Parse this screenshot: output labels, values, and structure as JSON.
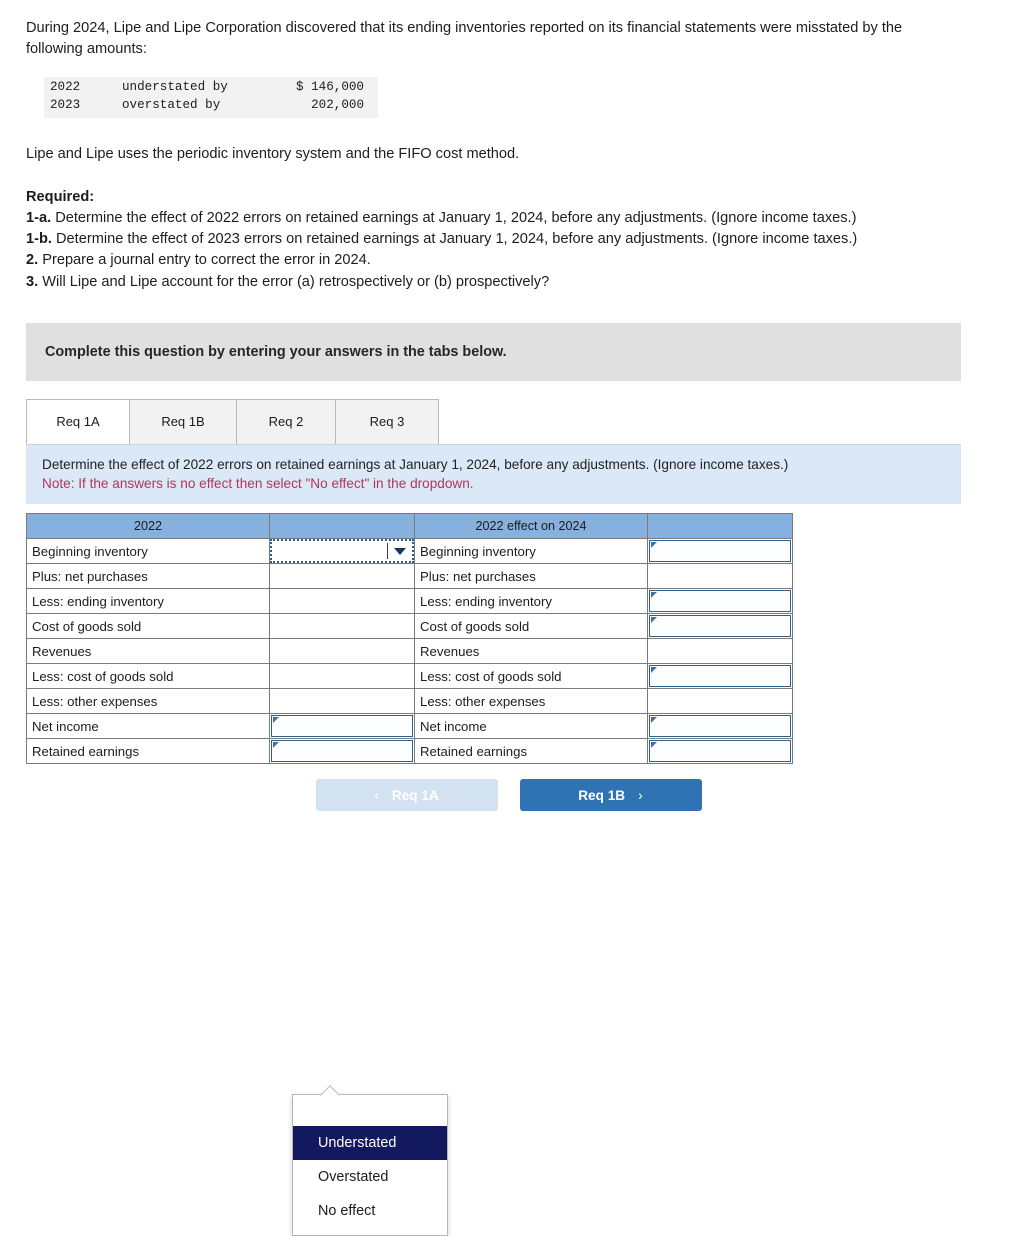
{
  "intro": {
    "text": "During 2024, Lipe and Lipe Corporation discovered that its ending inventories reported on its financial statements were misstated by the following amounts:"
  },
  "amounts_table": {
    "rows": [
      {
        "year": "2022",
        "description": "understated by",
        "amount": "$ 146,000"
      },
      {
        "year": "2023",
        "description": "overstated by",
        "amount": "202,000"
      }
    ]
  },
  "method_note": "Lipe and Lipe uses the periodic inventory system and the FIFO cost method.",
  "required": {
    "heading": "Required:",
    "items": [
      {
        "label": "1-a.",
        "text": "Determine the effect of 2022 errors on retained earnings at January 1, 2024, before any adjustments. (Ignore income taxes.)"
      },
      {
        "label": "1-b.",
        "text": "Determine the effect of 2023 errors on retained earnings at January 1, 2024, before any adjustments. (Ignore income taxes.)"
      },
      {
        "label": "2.",
        "text": "Prepare a journal entry to correct the error in 2024."
      },
      {
        "label": "3.",
        "text": "Will Lipe and Lipe account for the error (a) retrospectively or (b) prospectively?"
      }
    ]
  },
  "banner": {
    "text": "Complete this question by entering your answers in the tabs below."
  },
  "tabs": [
    {
      "label": "Req 1A",
      "active": true
    },
    {
      "label": "Req 1B",
      "active": false
    },
    {
      "label": "Req 2",
      "active": false
    },
    {
      "label": "Req 3",
      "active": false
    }
  ],
  "instruction": {
    "line1": "Determine the effect of 2022 errors on retained earnings at January 1, 2024, before any adjustments. (Ignore income taxes.)",
    "note": "Note: If the answers is no effect then select \"No effect\" in the dropdown."
  },
  "answer_table": {
    "headers": {
      "left": "2022",
      "left_input": "",
      "right": "2022 effect on 2024",
      "right_input": ""
    },
    "rows": [
      {
        "left_label": "Beginning inventory",
        "left_value": "",
        "left_control": "select-focused",
        "right_label": "Beginning inventory",
        "right_value": "",
        "right_control": "input"
      },
      {
        "left_label": "Plus: net purchases",
        "left_value": "",
        "left_control": "none",
        "right_label": "Plus: net purchases",
        "right_value": "",
        "right_control": "none"
      },
      {
        "left_label": "Less: ending inventory",
        "left_value": "",
        "left_control": "none",
        "right_label": "Less: ending inventory",
        "right_value": "",
        "right_control": "input"
      },
      {
        "left_label": "Cost of goods sold",
        "left_value": "",
        "left_control": "none",
        "right_label": "Cost of goods sold",
        "right_value": "",
        "right_control": "input"
      },
      {
        "left_label": "Revenues",
        "left_value": "",
        "left_control": "none",
        "right_label": "Revenues",
        "right_value": "",
        "right_control": "none"
      },
      {
        "left_label": "Less: cost of goods sold",
        "left_value": "",
        "left_control": "none",
        "right_label": "Less: cost of goods sold",
        "right_value": "",
        "right_control": "input"
      },
      {
        "left_label": "Less: other expenses",
        "left_value": "",
        "left_control": "none",
        "right_label": "Less: other expenses",
        "right_value": "",
        "right_control": "none"
      },
      {
        "left_label": "Net income",
        "left_value": "",
        "left_control": "input",
        "right_label": "Net income",
        "right_value": "",
        "right_control": "input"
      },
      {
        "left_label": "Retained earnings",
        "left_value": "",
        "left_control": "input",
        "right_label": "Retained earnings",
        "right_value": "",
        "right_control": "input"
      }
    ]
  },
  "dropdown": {
    "open": true,
    "options": [
      {
        "label": "Understated",
        "selected": true
      },
      {
        "label": "Overstated",
        "selected": false
      },
      {
        "label": "No effect",
        "selected": false
      }
    ]
  },
  "nav": {
    "prev_label": "Req 1A",
    "prev_arrow": "‹",
    "next_label": "Req 1B",
    "next_arrow": "›"
  },
  "colors": {
    "header_blue": "#86b0de",
    "instruction_bg": "#dbe8f7",
    "note_red": "#b1365a",
    "button_blue": "#2f73b4",
    "button_disabled": "#d3e2f0",
    "dropdown_selected": "#13195e"
  }
}
